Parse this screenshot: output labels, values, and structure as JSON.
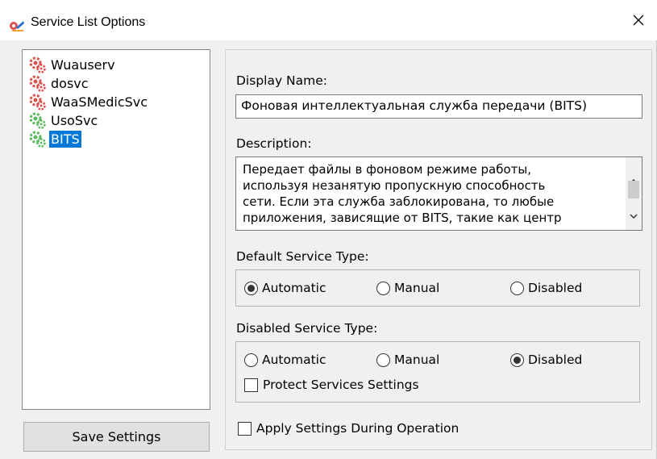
{
  "window": {
    "title": "Service List Options"
  },
  "services": [
    {
      "name": "Wuauserv",
      "status": "red",
      "selected": false
    },
    {
      "name": "dosvc",
      "status": "red",
      "selected": false
    },
    {
      "name": "WaaSMedicSvc",
      "status": "red",
      "selected": false
    },
    {
      "name": "UsoSvc",
      "status": "green",
      "selected": false
    },
    {
      "name": "BITS",
      "status": "green",
      "selected": true
    }
  ],
  "save_button": "Save Settings",
  "display_name": {
    "label": "Display Name:",
    "value": "Фоновая интеллектуальная служба передачи (BITS)"
  },
  "description": {
    "label": "Description:",
    "lines": [
      "Передает файлы в фоновом режиме работы,",
      "используя незанятую пропускную способность",
      "сети. Если эта служба заблокирована, то любые",
      "приложения, зависящие от BITS, такие как центр"
    ]
  },
  "default_type": {
    "label": "Default Service Type:",
    "options": [
      "Automatic",
      "Manual",
      "Disabled"
    ],
    "selected": "Automatic"
  },
  "disabled_type": {
    "label": "Disabled Service Type:",
    "options": [
      "Automatic",
      "Manual",
      "Disabled"
    ],
    "selected": "Disabled",
    "protect_label": "Protect Services Settings",
    "protect_checked": false
  },
  "apply_label": "Apply Settings During Operation",
  "apply_checked": false,
  "colors": {
    "selection": "#0078d7",
    "gear_red": "#d9534f",
    "gear_green": "#5cb85c"
  }
}
